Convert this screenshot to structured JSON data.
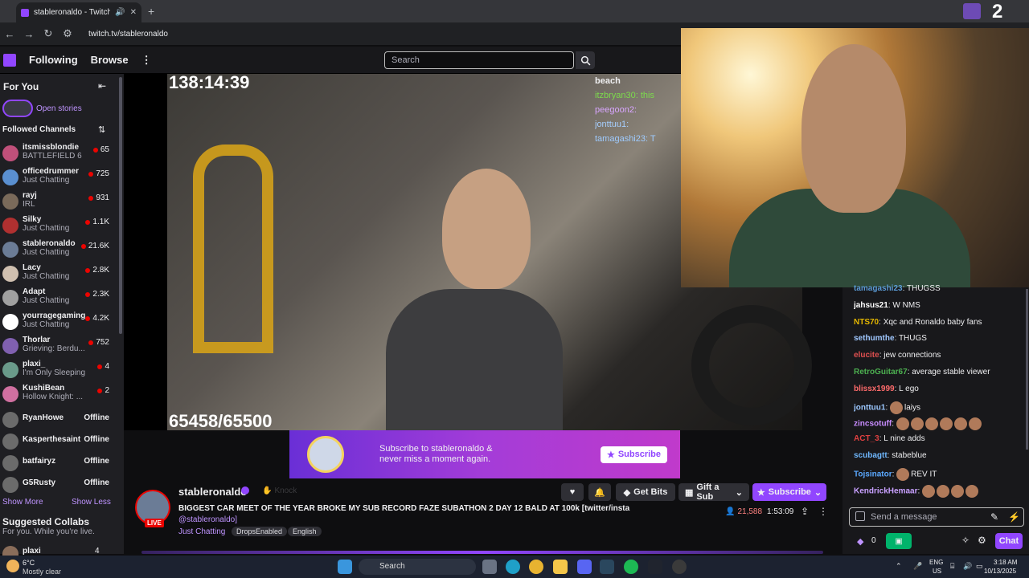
{
  "browser": {
    "tab_title": "stableronaldo - Twitch",
    "url": "twitch.tv/stableronaldo",
    "corner_text": "2"
  },
  "topnav": {
    "following": "Following",
    "browse": "Browse",
    "search_placeholder": "Search"
  },
  "sidebar": {
    "for_you": "For You",
    "open_stories": "Open stories",
    "followed_channels": "Followed Channels",
    "channels": [
      {
        "name": "itsmissblondie",
        "game": "BATTLEFIELD 6",
        "viewers": "65"
      },
      {
        "name": "officedrummer",
        "game": "Just Chatting",
        "viewers": "725"
      },
      {
        "name": "rayj",
        "game": "IRL",
        "viewers": "931"
      },
      {
        "name": "Silky",
        "game": "Just Chatting",
        "viewers": "1.1K"
      },
      {
        "name": "stableronaldo",
        "game": "Just Chatting",
        "viewers": "21.6K"
      },
      {
        "name": "Lacy",
        "game": "Just Chatting",
        "viewers": "2.8K"
      },
      {
        "name": "Adapt",
        "game": "Just Chatting",
        "viewers": "2.3K"
      },
      {
        "name": "yourragegaming",
        "game": "Just Chatting",
        "viewers": "4.2K"
      },
      {
        "name": "Thorlar",
        "game": "Grieving: Berdu...",
        "viewers": "752"
      },
      {
        "name": "plaxi_",
        "game": "I'm Only Sleeping",
        "viewers": "4"
      },
      {
        "name": "KushiBean",
        "game": "Hollow Knight: ...",
        "viewers": "2"
      }
    ],
    "offline": [
      {
        "name": "RyanHowe",
        "status": "Offline"
      },
      {
        "name": "Kasperthesaint",
        "status": "Offline"
      },
      {
        "name": "batfairyz",
        "status": "Offline"
      },
      {
        "name": "G5Rusty",
        "status": "Offline"
      }
    ],
    "show_more": "Show More",
    "show_less": "Show Less",
    "suggested_title": "Suggested Collabs",
    "suggested_sub": "For you. While you're live.",
    "suggested_channel": {
      "name": "plaxi",
      "viewers": "4"
    }
  },
  "video": {
    "timer": "138:14:39",
    "sub_goal": "65458/65500",
    "overlay_chat": [
      "beach",
      "itzbryan30: this",
      "peegoon2:",
      "jonttuu1:",
      "tamagashi23: T"
    ]
  },
  "banner": {
    "text": "Subscribe to stableronaldo & never miss a moment again.",
    "button": "Subscribe"
  },
  "stream": {
    "channel": "stableronaldo",
    "knock": "Knock",
    "live": "LIVE",
    "title": "BIGGEST CAR MEET OF THE YEAR BROKE MY SUB RECORD FAZE SUBATHON 2 DAY 12 BALD AT 100k [twitter/insta",
    "handle": "@stableronaldo]",
    "category": "Just Chatting",
    "tags": [
      "DropsEnabled",
      "English"
    ],
    "viewers": "21,588",
    "uptime": "1:53:09",
    "get_bits": "Get Bits",
    "gift_sub": "Gift a Sub",
    "subscribe": "Subscribe"
  },
  "chat": {
    "messages": [
      {
        "user": "tamagashi23",
        "text": "THUGSS",
        "color": "#5b9bd5"
      },
      {
        "user": "jahsus21",
        "text": "W  NMS",
        "color": "#ffffff"
      },
      {
        "user": "NTS70",
        "text": "Xqc and Ronaldo baby fans",
        "color": "#e6b800"
      },
      {
        "user": "sethumthe",
        "text": "THUGS",
        "color": "#a0c8ff"
      },
      {
        "user": "elucite",
        "text": "jew connections",
        "color": "#e05050"
      },
      {
        "user": "RetroGuitar67",
        "text": "average stable viewer",
        "color": "#4caf50"
      },
      {
        "user": "blissx1999",
        "text": "L ego",
        "color": "#ff6b6b"
      },
      {
        "user": "jonttuu1",
        "text": "laiys",
        "color": "#9cc8ff"
      },
      {
        "user": "zincsotuff",
        "text": "",
        "color": "#c88cff"
      },
      {
        "user": "ACT_3",
        "text": "L nine adds",
        "color": "#e04040"
      },
      {
        "user": "scubagtt",
        "text": "stabeblue",
        "color": "#6fb8ff"
      },
      {
        "user": "Tojsinator",
        "text": "REV IT",
        "color": "#5aa8ff"
      },
      {
        "user": "KendrickHemaar",
        "text": "",
        "color": "#c8a0ff"
      }
    ],
    "input_placeholder": "Send a message",
    "points": "0",
    "chat_button": "Chat"
  },
  "taskbar": {
    "temp": "6°C",
    "weather": "Mostly clear",
    "search": "Search",
    "lang": "ENG",
    "region": "US",
    "time": "3:18 AM",
    "date": "10/13/2025"
  }
}
